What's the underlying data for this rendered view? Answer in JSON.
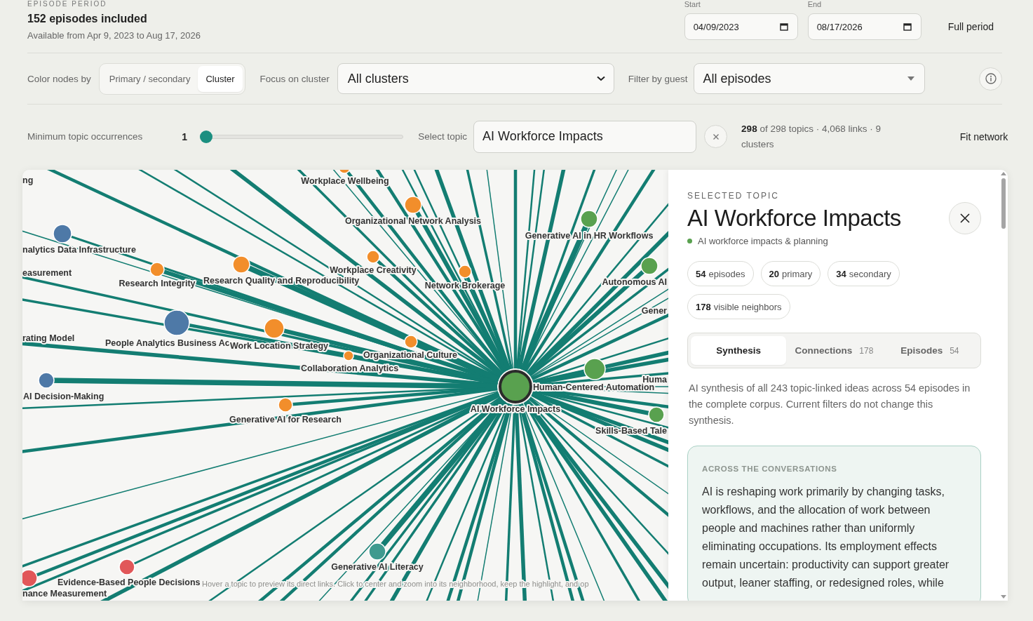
{
  "period": {
    "heading": "EPISODE PERIOD",
    "summary": "152 episodes included",
    "available": "Available from Apr 9, 2023 to Aug 17, 2026",
    "start": {
      "label": "Start",
      "value": "04/09/2023"
    },
    "end": {
      "label": "End",
      "value": "08/17/2026"
    },
    "reset_button": "Full period"
  },
  "filters": {
    "color_label": "Color nodes by",
    "color_modes": [
      {
        "label": "Primary / secondary",
        "selected": false
      },
      {
        "label": "Cluster",
        "selected": true
      }
    ],
    "cluster_label": "Focus on cluster",
    "cluster_value": "All clusters",
    "guest_label": "Filter by guest",
    "guest_value": "All episodes"
  },
  "topic_controls": {
    "min_slider": {
      "label": "Minimum topic occurrences",
      "value": "1",
      "level": 0
    },
    "select_label": "Select topic",
    "select_value": "AI Workforce Impacts",
    "stats": "**298** of 298 topics · 4,068 links · 9 clusters",
    "fit_button": "Fit network"
  },
  "graph": {
    "nodes": [
      {
        "label": "ng",
        "kind": "cut"
      },
      {
        "label": "Workplace Wellbeing",
        "color": "#f28e2b",
        "kind": "topic"
      },
      {
        "label": "Organizational Network Analysis",
        "color": "#f28e2b",
        "kind": "topic"
      },
      {
        "label": "Generative AI in HR Workflows",
        "color": "#59a14f",
        "kind": "topic"
      },
      {
        "label": "nalytics Data Infrastructure",
        "color": "#4e79a7",
        "kind": "topic"
      },
      {
        "label": "Workplace Creativity",
        "color": "#f28e2b",
        "kind": "topic"
      },
      {
        "label": "Research Integrity",
        "color": "#f28e2b",
        "kind": "topic"
      },
      {
        "label": "Research Quality and Reproducibility",
        "color": "#f28e2b",
        "kind": "topic"
      },
      {
        "label": "easurement",
        "kind": "cut"
      },
      {
        "label": "Network Brokerage",
        "color": "#f28e2b",
        "kind": "topic"
      },
      {
        "label": "Autonomous AI",
        "color": "#59a14f",
        "kind": "topic"
      },
      {
        "label": "Gener",
        "kind": "cut"
      },
      {
        "label": "rating Model",
        "kind": "cut"
      },
      {
        "label": "People Analytics Business Ac",
        "color": "#4e79a7",
        "kind": "topic"
      },
      {
        "label": "Work Location Strategy",
        "color": "#f28e2b",
        "kind": "topic"
      },
      {
        "label": "Organizational Culture",
        "color": "#f28e2b",
        "kind": "topic"
      },
      {
        "label": "Collaboration Analytics",
        "color": "#f28e2b",
        "kind": "topic"
      },
      {
        "label": "Human-Centered Automation",
        "color": "#59a14f",
        "kind": "topic"
      },
      {
        "label": "Huma",
        "kind": "cut"
      },
      {
        "label": "AI Decision-Making",
        "color": "#4e79a7",
        "kind": "topic"
      },
      {
        "label": "AI Workforce Impacts",
        "color": "#59a14f",
        "kind": "focus"
      },
      {
        "label": "Generative AI for Research",
        "color": "#f28e2b",
        "kind": "topic"
      },
      {
        "label": "Skills-Based Tale",
        "color": "#59a14f",
        "kind": "topic"
      },
      {
        "label": "Generative AI Literacy",
        "color": "#3f9a8f",
        "kind": "topic"
      },
      {
        "label": "Evidence-Based People Decisions",
        "color": "#e15759",
        "kind": "topic"
      },
      {
        "label": "nance Measurement",
        "color": "#e15759",
        "kind": "topic"
      }
    ],
    "hint": "Hover a topic to preview its direct links. Click to center and zoom into its neighborhood, keep the highlight, and op"
  },
  "panel": {
    "eyebrow": "SELECTED TOPIC",
    "title": "AI Workforce Impacts",
    "cluster": {
      "label": "AI workforce impacts & planning",
      "color": "#59a14f"
    },
    "chips": [
      "**54** episodes",
      "**20** primary",
      "**34** secondary",
      "**178** visible neighbors"
    ],
    "tabs": [
      {
        "label": "Synthesis",
        "selected": true
      },
      {
        "label": "Connections",
        "count": "178",
        "selected": false
      },
      {
        "label": "Episodes",
        "count": "54",
        "selected": false
      }
    ],
    "note": "AI synthesis of all 243 topic-linked ideas across 54 episodes in the complete corpus. Current filters do not change this synthesis.",
    "synthesis": {
      "heading": "ACROSS THE CONVERSATIONS",
      "body": "AI is reshaping work primarily by changing tasks, workflows, and the allocation of work between people and machines rather than uniformly eliminating occupations. Its employment effects remain uncertain: productivity can support greater output, leaner staffing, or redesigned roles, while"
    }
  }
}
